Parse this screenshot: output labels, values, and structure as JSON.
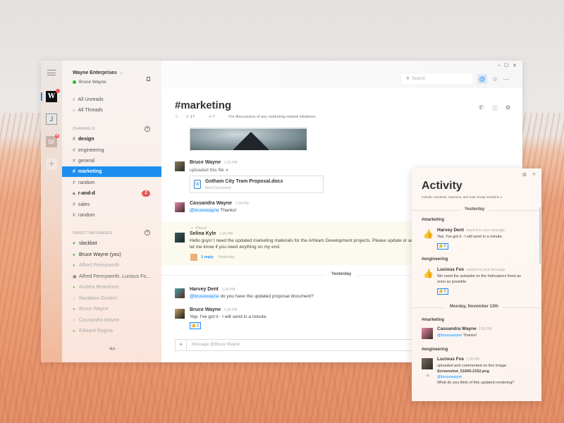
{
  "workspace": {
    "name": "Wayne Enterprises",
    "user": "Bruce Wayne",
    "status_color": "#2eb82e"
  },
  "rail": {
    "teams": [
      {
        "label": "W",
        "badge": ""
      },
      {
        "label": "J",
        "badge": ""
      },
      {
        "label": "SF",
        "badge": "4"
      }
    ],
    "add_label": "+"
  },
  "sidebar": {
    "nav": [
      {
        "label": "All Unreads",
        "icon": "unreads-icon"
      },
      {
        "label": "All Threads",
        "icon": "threads-icon"
      }
    ],
    "channels_header": "CHANNELS",
    "channels": [
      {
        "name": "design",
        "state": "bold",
        "unread": ""
      },
      {
        "name": "engineering",
        "state": "normal",
        "unread": ""
      },
      {
        "name": "general",
        "state": "normal",
        "unread": ""
      },
      {
        "name": "marketing",
        "state": "active",
        "unread": ""
      },
      {
        "name": "random",
        "state": "normal",
        "unread": ""
      },
      {
        "name": "r-and-d",
        "state": "bold-private",
        "unread": "2"
      },
      {
        "name": "sales",
        "state": "normal",
        "unread": ""
      },
      {
        "name": "random",
        "state": "normal",
        "unread": ""
      }
    ],
    "dm_header": "DIRECT MESSAGES",
    "dms": [
      {
        "name": "slackbot",
        "status": "bot",
        "bold": true
      },
      {
        "name": "Bruce Wayne (you)",
        "status": "online",
        "bold": true
      },
      {
        "name": "Alfred Pennyworth",
        "status": "online",
        "bold": false
      },
      {
        "name": "Alfred Pennyworth, Lucious Fo...",
        "status": "group",
        "bold": false
      },
      {
        "name": "Andrea Beaumont",
        "status": "online",
        "bold": false
      },
      {
        "name": "Barabara Gordon",
        "status": "away",
        "bold": false
      },
      {
        "name": "Bruce Wayne",
        "status": "online",
        "bold": false
      },
      {
        "name": "Cassandra Wayne",
        "status": "away",
        "bold": false
      },
      {
        "name": "Edward Nygma",
        "status": "online",
        "bold": false
      }
    ]
  },
  "topbar": {
    "search_placeholder": "Search",
    "window_controls": [
      "–",
      "☐",
      "✕"
    ]
  },
  "channel": {
    "title": "#marketing",
    "members": "17",
    "pinned": "7",
    "description": "For discussions of any marketing related initiatives."
  },
  "messages": [
    {
      "author": "Bruce Wayne",
      "time": "1:26 PM",
      "text": "uploaded this file ∨",
      "file": {
        "name": "Gotham City Tram Proposal.docx",
        "type": "Word Document"
      }
    },
    {
      "author": "Cassandra Wayne",
      "time": "1:26 PM",
      "mention": "@brucewayne",
      "text": " Thanks!"
    },
    {
      "pinned_label": "Pinned",
      "author": "Selina Kyle",
      "time": "1:26 PM",
      "text1": "Hello guys! I need the updated marketing materials for the Arhkam Development projects. Please update or add",
      "text2": "let me know if you need anything on my end.",
      "replies": "1 reply",
      "reply_time": "Yesterday"
    },
    {
      "author": "Harvey Dent",
      "time": "1:26 PM",
      "mention": "@brucewayne",
      "text": " do you have the updated proposal document?"
    },
    {
      "author": "Bruce Wayne",
      "time": "1:26 PM",
      "text": "Yep. I've got it - I will send in a minute.",
      "reaction": "👍 1"
    }
  ],
  "day_divider": "Yesterday",
  "composer": {
    "placeholder": "Message @Bruce Wayne"
  },
  "activity": {
    "title": "Activity",
    "subtitle": "Include: mentions, reactions, and User Group mentions ∨",
    "groups": [
      {
        "day": "Yesterday",
        "items": [
          {
            "channel": "#marketing",
            "author": "Harvey Dent",
            "action": "reacted to your message.",
            "text": "Yep. I've got it - I will send in a minute.",
            "reaction": "👍 1"
          },
          {
            "channel": "#engineering",
            "author": "Lucious Fox",
            "action": "reacted to your message.",
            "text": "We need the autopilot on the helicopters fixed as soon as possible.",
            "reaction": "👍 1"
          }
        ]
      },
      {
        "day": "Monday, November 13th",
        "items": [
          {
            "channel": "#marketing",
            "author": "Cassandra Wayne",
            "time": "1:26 PM",
            "mention": "@brucewayne",
            "text": " Thanks!"
          },
          {
            "channel": "#engineering",
            "author": "Lucious Fox",
            "time": "1:26 PM",
            "action": "uploaded and commented on this image:",
            "file": "Screenshot_51665-2152.png",
            "mention": "@brucewayne",
            "text": "What do you think of this updated rendering?"
          }
        ]
      }
    ]
  },
  "colors": {
    "accent": "#1e8ff0",
    "badge": "#e35a5a",
    "online": "#2eb82e",
    "pinned_bg": "#fcfaee"
  }
}
